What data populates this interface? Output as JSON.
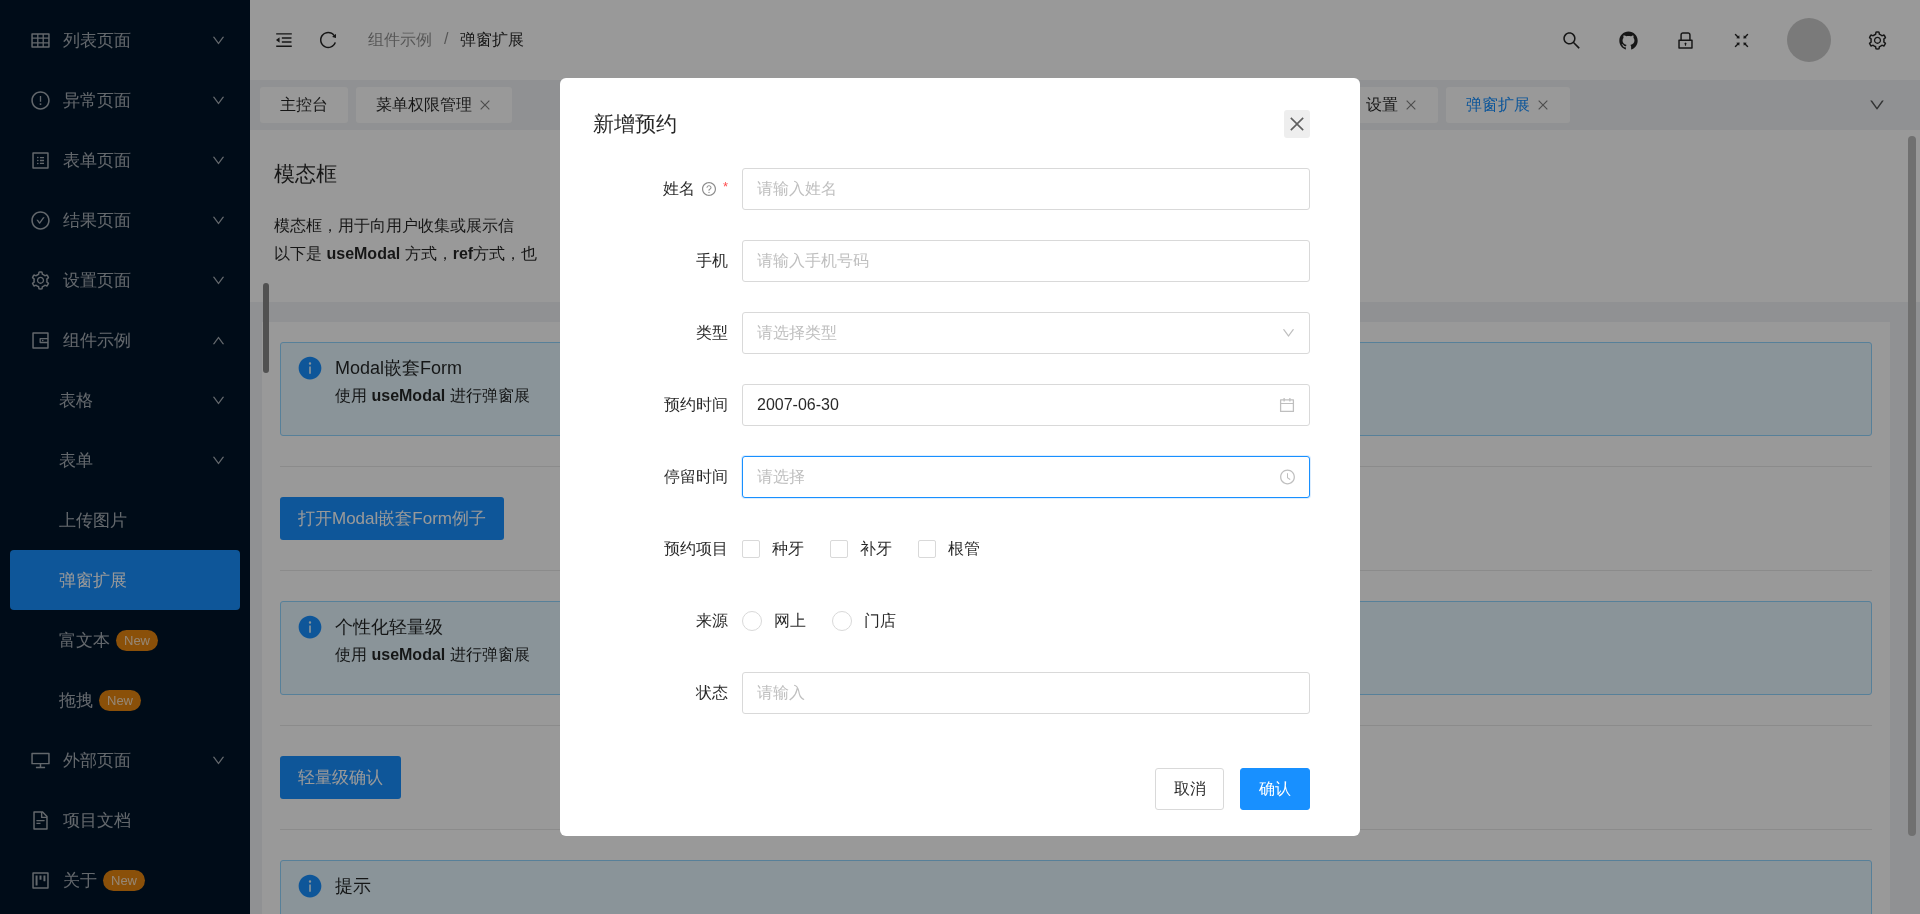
{
  "sidebar": {
    "items": [
      {
        "label": "列表页面",
        "expanded": false,
        "selected": false
      },
      {
        "label": "异常页面",
        "expanded": false,
        "selected": false
      },
      {
        "label": "表单页面",
        "expanded": false,
        "selected": false
      },
      {
        "label": "结果页面",
        "expanded": false,
        "selected": false
      },
      {
        "label": "设置页面",
        "expanded": false,
        "selected": false
      },
      {
        "label": "组件示例",
        "expanded": true,
        "selected": false,
        "children": [
          {
            "label": "表格",
            "expanded": false,
            "selected": false
          },
          {
            "label": "表单",
            "expanded": false,
            "selected": false
          },
          {
            "label": "上传图片",
            "selected": false
          },
          {
            "label": "弹窗扩展",
            "selected": true
          },
          {
            "label": "富文本",
            "badge": "New",
            "selected": false
          },
          {
            "label": "拖拽",
            "badge": "New",
            "selected": false
          }
        ]
      },
      {
        "label": "外部页面",
        "expanded": false,
        "selected": false
      },
      {
        "label": "项目文档",
        "selected": false
      },
      {
        "label": "关于",
        "badge": "New",
        "selected": false
      }
    ]
  },
  "header": {
    "breadcrumb": [
      "组件示例",
      "弹窗扩展"
    ],
    "separator": "/"
  },
  "tabs": [
    {
      "label": "主控台",
      "closable": false,
      "selected": false
    },
    {
      "label": "菜单权限管理",
      "closable": true,
      "selected": false
    },
    {
      "label": "设置",
      "closable": true,
      "selected": false
    },
    {
      "label": "弹窗扩展",
      "closable": true,
      "selected": true
    }
  ],
  "page_header": {
    "title": "模态框",
    "description": [
      "模态框，用于向用户收集或展示信",
      "以下是 **useModal** 方式，**ref**方式，也"
    ]
  },
  "sections": [
    {
      "kind": "alert",
      "title": "Modal嵌套Form",
      "description": "使用 **useModal** 进行弹窗展"
    },
    {
      "kind": "button",
      "label": "打开Modal嵌套Form例子"
    },
    {
      "kind": "alert",
      "title": "个性化轻量级",
      "description": "使用 **useModal** 进行弹窗展"
    },
    {
      "kind": "button",
      "label": "轻量级确认"
    },
    {
      "kind": "alert",
      "title": "提示"
    }
  ],
  "modal": {
    "title": "新增预约",
    "fields": [
      {
        "kind": "input",
        "label": "姓名",
        "required_mark": "*",
        "help": true,
        "placeholder": "请输入姓名",
        "focused": false
      },
      {
        "kind": "input",
        "label": "手机",
        "help": false,
        "placeholder": "请输入手机号码",
        "focused": false
      },
      {
        "kind": "select",
        "label": "类型",
        "help": false,
        "placeholder": "请选择类型",
        "focused": false
      },
      {
        "kind": "date",
        "label": "预约时间",
        "help": false,
        "value": "2007-06-30",
        "focused": false
      },
      {
        "kind": "time",
        "label": "停留时间",
        "help": false,
        "placeholder": "请选择",
        "focused": true
      },
      {
        "kind": "checkboxes",
        "label": "预约项目",
        "help": false,
        "options": [
          {
            "label": "种牙",
            "checked": false
          },
          {
            "label": "补牙",
            "checked": false
          },
          {
            "label": "根管",
            "checked": false
          }
        ]
      },
      {
        "kind": "radios",
        "label": "来源",
        "help": false,
        "options": [
          {
            "label": "网上",
            "selected": false
          },
          {
            "label": "门店",
            "selected": false
          }
        ]
      },
      {
        "kind": "input",
        "label": "状态",
        "help": false,
        "placeholder": "请输入",
        "focused": false
      }
    ],
    "buttons": [
      {
        "label": "取消",
        "primary": false
      },
      {
        "label": "确认",
        "primary": true
      }
    ]
  }
}
